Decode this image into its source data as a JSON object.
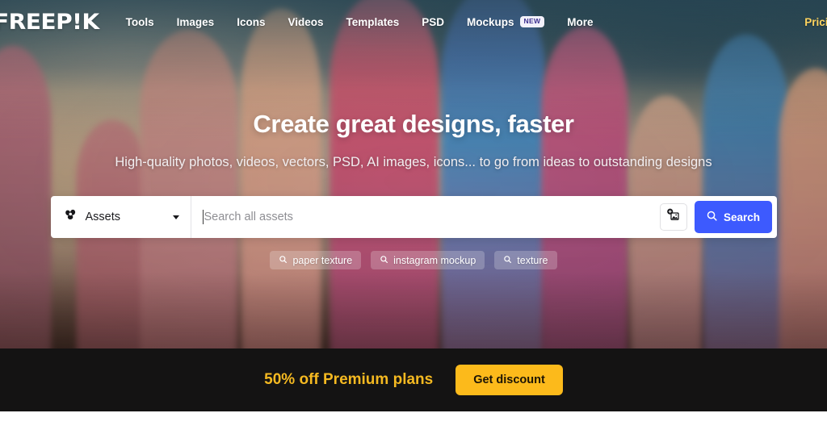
{
  "brand": {
    "logo_text": "FREEP!K",
    "accent_blue": "#3d5afe",
    "accent_yellow": "#fcba1b",
    "pricing_color": "#ffd45e",
    "banner_bg": "#141313"
  },
  "nav": {
    "items": [
      {
        "label": "Tools",
        "badge": ""
      },
      {
        "label": "Images",
        "badge": ""
      },
      {
        "label": "Icons",
        "badge": ""
      },
      {
        "label": "Videos",
        "badge": ""
      },
      {
        "label": "Templates",
        "badge": ""
      },
      {
        "label": "PSD",
        "badge": ""
      },
      {
        "label": "Mockups",
        "badge": "NEW"
      },
      {
        "label": "More",
        "badge": ""
      }
    ],
    "pricing_label": "Pricing"
  },
  "hero": {
    "title": "Create great designs, faster",
    "subtitle": "High-quality photos, videos, vectors, PSD, AI images, icons... to go from ideas to outstanding designs"
  },
  "search": {
    "category_label": "Assets",
    "category_icon": "assets-shapes-icon",
    "dropdown_icon": "chevron-down-icon",
    "placeholder": "Search all assets",
    "value": "",
    "image_search_icon": "add-image-icon",
    "search_icon": "search-icon",
    "search_button_label": "Search"
  },
  "suggestions": {
    "icon": "search-icon",
    "chips": [
      {
        "label": "paper texture"
      },
      {
        "label": "instagram mockup"
      },
      {
        "label": "texture"
      }
    ]
  },
  "promo": {
    "text": "50% off Premium plans",
    "button_label": "Get discount"
  }
}
